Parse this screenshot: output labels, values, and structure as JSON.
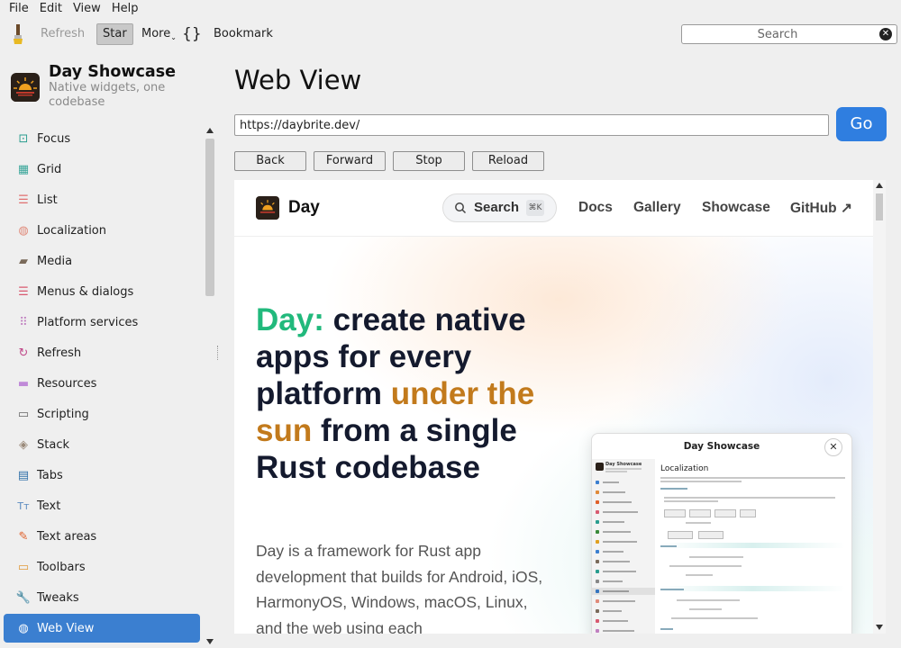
{
  "menubar": {
    "items": [
      "File",
      "Edit",
      "View",
      "Help"
    ]
  },
  "toolbar": {
    "refresh_label": "Refresh",
    "star_label": "Star",
    "more_label": "More",
    "braces_label": "{}",
    "bookmark_label": "Bookmark",
    "search_placeholder": "Search"
  },
  "app": {
    "title": "Day Showcase",
    "subtitle": "Native widgets, one codebase"
  },
  "sidebar": {
    "items": [
      {
        "label": "Focus",
        "icon": "focus-icon",
        "color": "#2a9d8f"
      },
      {
        "label": "Grid",
        "icon": "grid-icon",
        "color": "#3aa69a"
      },
      {
        "label": "List",
        "icon": "list-icon",
        "color": "#e07070"
      },
      {
        "label": "Localization",
        "icon": "globe-icon",
        "color": "#e08a7a"
      },
      {
        "label": "Media",
        "icon": "film-icon",
        "color": "#7a6a5a"
      },
      {
        "label": "Menus & dialogs",
        "icon": "menu-icon",
        "color": "#d85a70"
      },
      {
        "label": "Platform services",
        "icon": "dots-grid-icon",
        "color": "#c080c0"
      },
      {
        "label": "Refresh",
        "icon": "refresh-icon",
        "color": "#c04a8a"
      },
      {
        "label": "Resources",
        "icon": "folder-icon",
        "color": "#c08ad8"
      },
      {
        "label": "Scripting",
        "icon": "terminal-icon",
        "color": "#666666"
      },
      {
        "label": "Stack",
        "icon": "stack-icon",
        "color": "#9a8a7a"
      },
      {
        "label": "Tabs",
        "icon": "tabs-icon",
        "color": "#2f6fa8"
      },
      {
        "label": "Text",
        "icon": "text-icon",
        "color": "#5a8ac0"
      },
      {
        "label": "Text areas",
        "icon": "pencil-icon",
        "color": "#e0602a"
      },
      {
        "label": "Toolbars",
        "icon": "toolbar-icon",
        "color": "#e09a3a"
      },
      {
        "label": "Tweaks",
        "icon": "wrench-icon",
        "color": "#3a8a3a"
      },
      {
        "label": "Web View",
        "icon": "web-icon",
        "color": "#ffffff",
        "active": true
      }
    ]
  },
  "main": {
    "title": "Web View",
    "url": "https://daybrite.dev/",
    "go_label": "Go",
    "buttons": {
      "back": "Back",
      "forward": "Forward",
      "stop": "Stop",
      "reload": "Reload"
    }
  },
  "webpage": {
    "site_name": "Day",
    "search_label": "Search",
    "search_shortcut": "⌘K",
    "nav": [
      "Docs",
      "Gallery",
      "Showcase",
      "GitHub ↗"
    ],
    "hero": {
      "accent": "Day:",
      "line1": " create native apps for every platform",
      "highlight": "under the sun",
      "line2": "from a single Rust codebase"
    },
    "body": "Day is a framework for Rust app development that builds for Android, iOS, HarmonyOS, Windows, macOS, Linux, and the web using each",
    "preview": {
      "title": "Day Showcase",
      "close": "✕",
      "side_title": "Day Showcase",
      "section": "Localization"
    }
  },
  "colors": {
    "accent": "#3b7fd0",
    "go_button": "#2f7ee0",
    "hero_green": "#21b97c",
    "hero_orange": "#c27a1c"
  }
}
